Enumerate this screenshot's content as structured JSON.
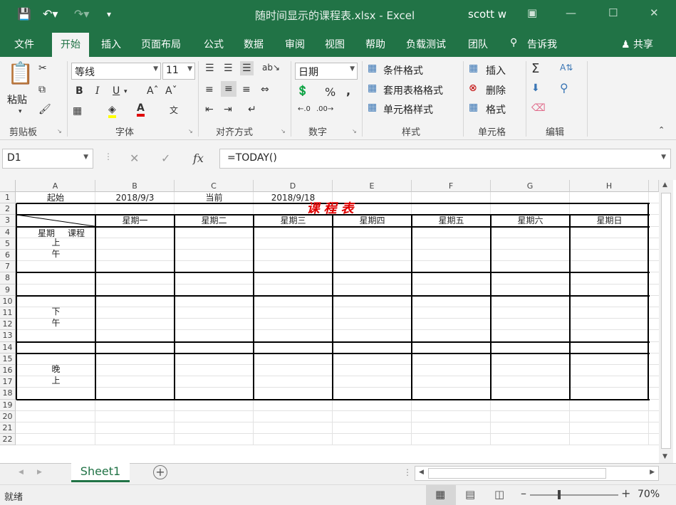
{
  "window": {
    "title": "随时间显示的课程表.xlsx  -  Excel",
    "user": "scott w"
  },
  "tabs": [
    "文件",
    "开始",
    "插入",
    "页面布局",
    "公式",
    "数据",
    "审阅",
    "视图",
    "帮助",
    "负载测试",
    "团队"
  ],
  "tell_me": "告诉我",
  "share": "共享",
  "ribbon": {
    "paste": "粘贴",
    "clipboard_label": "剪贴板",
    "font_name": "等线",
    "font_size": "11",
    "font_label": "字体",
    "align_label": "对齐方式",
    "number_format": "日期",
    "number_label": "数字",
    "conditional_format": "条件格式",
    "table_format": "套用表格格式",
    "cell_style": "单元格样式",
    "styles_label": "样式",
    "insert": "插入",
    "delete": "删除",
    "format": "格式",
    "cells_label": "单元格",
    "editing_label": "编辑",
    "bold": "B",
    "italic": "I",
    "underline": "U",
    "percent": "%",
    "comma": ","
  },
  "formula_bar": {
    "name_box": "D1",
    "formula": "=TODAY()"
  },
  "columns": [
    "A",
    "B",
    "C",
    "D",
    "E",
    "F",
    "G",
    "H"
  ],
  "rows": [
    "1",
    "2",
    "3",
    "4",
    "5",
    "6",
    "7",
    "8",
    "9",
    "10",
    "11",
    "12",
    "13",
    "14",
    "15",
    "16",
    "17",
    "18",
    "19",
    "20",
    "21",
    "22"
  ],
  "cells": {
    "a1": "起始",
    "b1": "2018/9/3",
    "c1": "当前",
    "d1": "2018/9/18",
    "title": "课程表",
    "corner_left": "星期",
    "corner_right": "课程",
    "weekdays": [
      "星期一",
      "星期二",
      "星期三",
      "星期四",
      "星期五",
      "星期六",
      "星期日"
    ],
    "morning": [
      "上",
      "午"
    ],
    "afternoon": [
      "下",
      "午"
    ],
    "evening": [
      "晚",
      "上"
    ]
  },
  "sheet_tab": "Sheet1",
  "status": {
    "ready": "就绪",
    "zoom": "70%",
    "zoom_level": 0.7
  },
  "colors": {
    "brand": "#217346",
    "title_red": "#e00000"
  }
}
